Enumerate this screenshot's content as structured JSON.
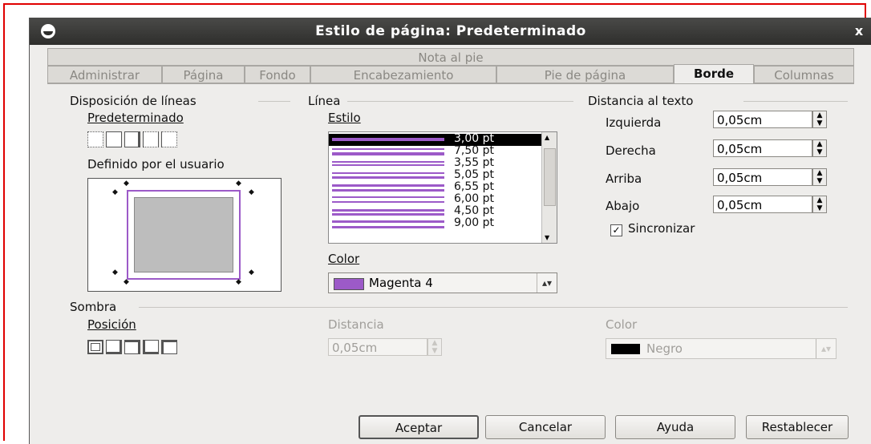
{
  "window": {
    "title": "Estilo de página: Predeterminado",
    "close_glyph": "x"
  },
  "tabs": {
    "row1": [
      "Nota al pie"
    ],
    "row2": [
      "Administrar",
      "Página",
      "Fondo",
      "Encabezamiento",
      "Pie de página",
      "Borde",
      "Columnas"
    ],
    "active": "Borde"
  },
  "line_arrangement": {
    "heading": "Disposición de líneas",
    "default_label": "Predeterminado",
    "user_defined_label": "Definido por el usuario"
  },
  "line": {
    "heading": "Línea",
    "style_label": "Estilo",
    "styles": [
      "3,00 pt",
      "7,50 pt",
      "3,55 pt",
      "5,05 pt",
      "6,55 pt",
      "6,00 pt",
      "4,50 pt",
      "9,00 pt"
    ],
    "selected_style": "3,00 pt",
    "color_label": "Color",
    "color_value": "Magenta 4",
    "color_swatch": "#9c5ac8"
  },
  "spacing": {
    "heading": "Distancia al texto",
    "left_label": "Izquierda",
    "left_value": "0,05cm",
    "right_label": "Derecha",
    "right_value": "0,05cm",
    "top_label": "Arriba",
    "top_value": "0,05cm",
    "bottom_label": "Abajo",
    "bottom_value": "0,05cm",
    "sync_label": "Sincronizar",
    "sync_checked": true
  },
  "shadow": {
    "heading": "Sombra",
    "position_label": "Posición",
    "distance_label": "Distancia",
    "distance_value": "0,05cm",
    "color_label": "Color",
    "color_value": "Negro",
    "color_swatch": "#000000"
  },
  "buttons": {
    "ok": "Aceptar",
    "cancel": "Cancelar",
    "help": "Ayuda",
    "reset": "Restablecer"
  }
}
